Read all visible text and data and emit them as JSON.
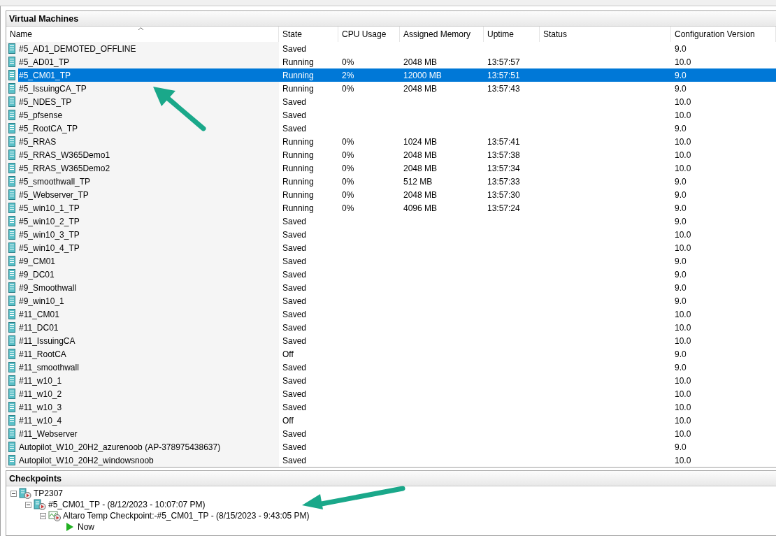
{
  "vm_panel": {
    "title": "Virtual Machines",
    "columns": [
      "Name",
      "State",
      "CPU Usage",
      "Assigned Memory",
      "Uptime",
      "Status",
      "Configuration Version"
    ],
    "rows": [
      {
        "name": "#5_AD1_DEMOTED_OFFLINE",
        "state": "Saved",
        "version": "9.0",
        "selected": false
      },
      {
        "name": "#5_AD01_TP",
        "state": "Running",
        "cpu": "0%",
        "memory": "2048 MB",
        "uptime": "13:57:57",
        "version": "10.0",
        "selected": false
      },
      {
        "name": "#5_CM01_TP",
        "state": "Running",
        "cpu": "2%",
        "memory": "12000 MB",
        "uptime": "13:57:51",
        "version": "9.0",
        "selected": true
      },
      {
        "name": "#5_IssuingCA_TP",
        "state": "Running",
        "cpu": "0%",
        "memory": "2048 MB",
        "uptime": "13:57:43",
        "version": "9.0",
        "selected": false
      },
      {
        "name": "#5_NDES_TP",
        "state": "Saved",
        "version": "10.0",
        "selected": false
      },
      {
        "name": "#5_pfsense",
        "state": "Saved",
        "version": "10.0",
        "selected": false
      },
      {
        "name": "#5_RootCA_TP",
        "state": "Saved",
        "version": "9.0",
        "selected": false
      },
      {
        "name": "#5_RRAS",
        "state": "Running",
        "cpu": "0%",
        "memory": "1024 MB",
        "uptime": "13:57:41",
        "version": "10.0",
        "selected": false
      },
      {
        "name": "#5_RRAS_W365Demo1",
        "state": "Running",
        "cpu": "0%",
        "memory": "2048 MB",
        "uptime": "13:57:38",
        "version": "10.0",
        "selected": false
      },
      {
        "name": "#5_RRAS_W365Demo2",
        "state": "Running",
        "cpu": "0%",
        "memory": "2048 MB",
        "uptime": "13:57:34",
        "version": "10.0",
        "selected": false
      },
      {
        "name": "#5_smoothwall_TP",
        "state": "Running",
        "cpu": "0%",
        "memory": "512 MB",
        "uptime": "13:57:33",
        "version": "9.0",
        "selected": false
      },
      {
        "name": "#5_Webserver_TP",
        "state": "Running",
        "cpu": "0%",
        "memory": "2048 MB",
        "uptime": "13:57:30",
        "version": "9.0",
        "selected": false
      },
      {
        "name": "#5_win10_1_TP",
        "state": "Running",
        "cpu": "0%",
        "memory": "4096 MB",
        "uptime": "13:57:24",
        "version": "9.0",
        "selected": false
      },
      {
        "name": "#5_win10_2_TP",
        "state": "Saved",
        "version": "9.0",
        "selected": false
      },
      {
        "name": "#5_win10_3_TP",
        "state": "Saved",
        "version": "10.0",
        "selected": false
      },
      {
        "name": "#5_win10_4_TP",
        "state": "Saved",
        "version": "10.0",
        "selected": false
      },
      {
        "name": "#9_CM01",
        "state": "Saved",
        "version": "9.0",
        "selected": false
      },
      {
        "name": "#9_DC01",
        "state": "Saved",
        "version": "9.0",
        "selected": false
      },
      {
        "name": "#9_Smoothwall",
        "state": "Saved",
        "version": "9.0",
        "selected": false
      },
      {
        "name": "#9_win10_1",
        "state": "Saved",
        "version": "9.0",
        "selected": false
      },
      {
        "name": "#11_CM01",
        "state": "Saved",
        "version": "10.0",
        "selected": false
      },
      {
        "name": "#11_DC01",
        "state": "Saved",
        "version": "10.0",
        "selected": false
      },
      {
        "name": "#11_IssuingCA",
        "state": "Saved",
        "version": "10.0",
        "selected": false
      },
      {
        "name": "#11_RootCA",
        "state": "Off",
        "version": "9.0",
        "selected": false
      },
      {
        "name": "#11_smoothwall",
        "state": "Saved",
        "version": "9.0",
        "selected": false
      },
      {
        "name": "#11_w10_1",
        "state": "Saved",
        "version": "10.0",
        "selected": false
      },
      {
        "name": "#11_w10_2",
        "state": "Saved",
        "version": "10.0",
        "selected": false
      },
      {
        "name": "#11_w10_3",
        "state": "Saved",
        "version": "10.0",
        "selected": false
      },
      {
        "name": "#11_w10_4",
        "state": "Off",
        "version": "10.0",
        "selected": false
      },
      {
        "name": "#11_Webserver",
        "state": "Saved",
        "version": "10.0",
        "selected": false
      },
      {
        "name": "Autopilot_W10_20H2_azurenoob (AP-378975438637)",
        "state": "Saved",
        "version": "9.0",
        "selected": false
      },
      {
        "name": "Autopilot_W10_20H2_windowsnoob",
        "state": "Saved",
        "version": "10.0",
        "selected": false
      }
    ]
  },
  "checkpoints_panel": {
    "title": "Checkpoints",
    "tree": [
      {
        "kind": "vm",
        "label": "TP2307",
        "expanded": true,
        "children": [
          {
            "kind": "vm",
            "label": "#5_CM01_TP - (8/12/2023 - 10:07:07 PM)",
            "expanded": true,
            "children": [
              {
                "kind": "checkpoint",
                "label": "Altaro Temp Checkpoint:-#5_CM01_TP - (8/15/2023 - 9:43:05 PM)",
                "expanded": true,
                "children": [
                  {
                    "kind": "now",
                    "label": "Now"
                  }
                ]
              }
            ]
          }
        ]
      }
    ]
  }
}
